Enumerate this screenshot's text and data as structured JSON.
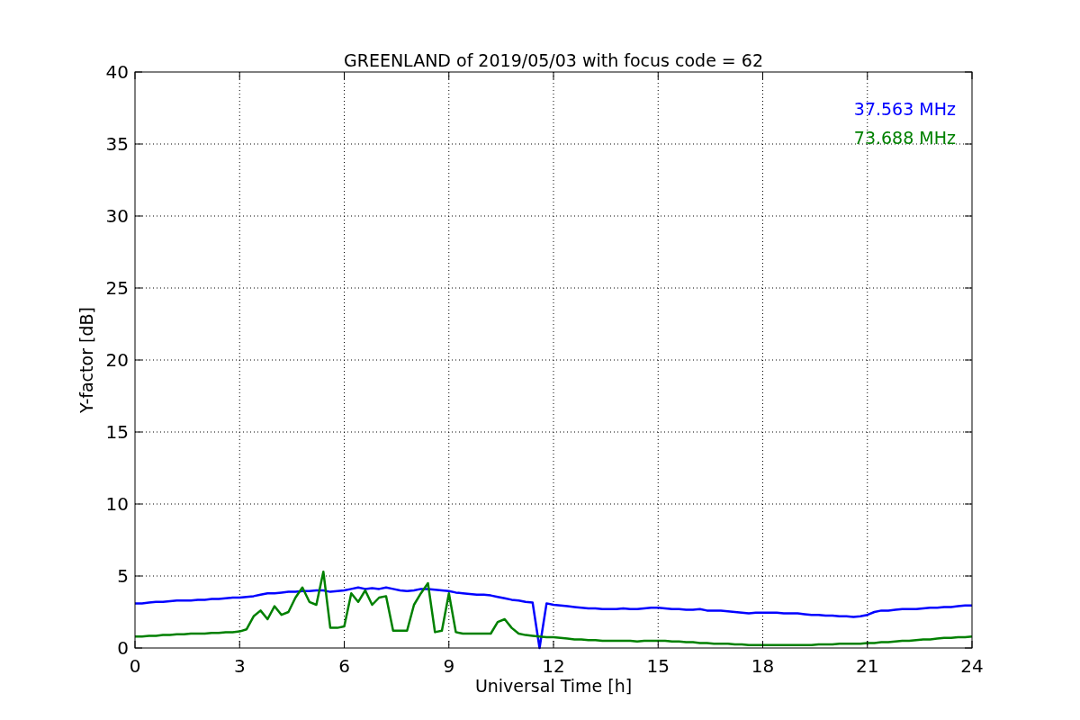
{
  "chart_data": {
    "type": "line",
    "title": "GREENLAND of 2019/05/03 with focus code = 62",
    "xlabel": "Universal Time [h]",
    "ylabel": "Y-factor [dB]",
    "x": [
      0,
      0.2,
      0.4,
      0.6,
      0.8,
      1,
      1.2,
      1.4,
      1.6,
      1.8,
      2,
      2.2,
      2.4,
      2.6,
      2.8,
      3,
      3.2,
      3.4,
      3.6,
      3.8,
      4,
      4.2,
      4.4,
      4.6,
      4.8,
      5,
      5.2,
      5.4,
      5.6,
      5.8,
      6,
      6.2,
      6.4,
      6.6,
      6.8,
      7,
      7.2,
      7.4,
      7.6,
      7.8,
      8,
      8.2,
      8.4,
      8.6,
      8.8,
      9,
      9.2,
      9.4,
      9.6,
      9.8,
      10,
      10.2,
      10.4,
      10.6,
      10.8,
      11,
      11.2,
      11.4,
      11.6,
      11.8,
      12,
      12.2,
      12.4,
      12.6,
      12.8,
      13,
      13.2,
      13.4,
      13.6,
      13.8,
      14,
      14.2,
      14.4,
      14.6,
      14.8,
      15,
      15.2,
      15.4,
      15.6,
      15.8,
      16,
      16.2,
      16.4,
      16.6,
      16.8,
      17,
      17.2,
      17.4,
      17.6,
      17.8,
      18,
      18.2,
      18.4,
      18.6,
      18.8,
      19,
      19.2,
      19.4,
      19.6,
      19.8,
      20,
      20.2,
      20.4,
      20.6,
      20.8,
      21,
      21.2,
      21.4,
      21.6,
      21.8,
      22,
      22.2,
      22.4,
      22.6,
      22.8,
      23,
      23.2,
      23.4,
      23.6,
      23.8,
      24
    ],
    "series": [
      {
        "name": "37.563 MHz",
        "color": "#0000ff",
        "values": [
          3.1,
          3.1,
          3.15,
          3.2,
          3.2,
          3.25,
          3.3,
          3.3,
          3.3,
          3.35,
          3.35,
          3.4,
          3.4,
          3.45,
          3.5,
          3.5,
          3.55,
          3.6,
          3.7,
          3.8,
          3.8,
          3.85,
          3.9,
          3.9,
          3.95,
          3.95,
          4.0,
          4.0,
          3.9,
          3.95,
          4.0,
          4.1,
          4.2,
          4.1,
          4.15,
          4.1,
          4.2,
          4.1,
          4.0,
          3.95,
          4.0,
          4.1,
          4.1,
          4.05,
          4.0,
          3.95,
          3.85,
          3.8,
          3.75,
          3.7,
          3.7,
          3.65,
          3.55,
          3.45,
          3.35,
          3.3,
          3.2,
          3.15,
          0,
          3.1,
          3.0,
          2.95,
          2.9,
          2.85,
          2.8,
          2.75,
          2.75,
          2.7,
          2.7,
          2.7,
          2.75,
          2.7,
          2.7,
          2.75,
          2.8,
          2.8,
          2.75,
          2.7,
          2.7,
          2.65,
          2.65,
          2.7,
          2.6,
          2.6,
          2.6,
          2.55,
          2.5,
          2.45,
          2.4,
          2.45,
          2.45,
          2.45,
          2.45,
          2.4,
          2.4,
          2.4,
          2.35,
          2.3,
          2.3,
          2.25,
          2.25,
          2.2,
          2.2,
          2.15,
          2.2,
          2.3,
          2.5,
          2.6,
          2.6,
          2.65,
          2.7,
          2.7,
          2.7,
          2.75,
          2.8,
          2.8,
          2.85,
          2.85,
          2.9,
          2.95,
          2.95
        ]
      },
      {
        "name": "73.688 MHz",
        "color": "#008000",
        "values": [
          0.8,
          0.8,
          0.85,
          0.85,
          0.9,
          0.9,
          0.95,
          0.95,
          1.0,
          1.0,
          1.0,
          1.05,
          1.05,
          1.1,
          1.1,
          1.15,
          1.3,
          2.2,
          2.6,
          2.0,
          2.9,
          2.3,
          2.5,
          3.5,
          4.2,
          3.2,
          3.0,
          5.3,
          1.4,
          1.4,
          1.5,
          3.8,
          3.2,
          4.0,
          3.0,
          3.5,
          3.6,
          1.2,
          1.2,
          1.2,
          3.0,
          3.8,
          4.5,
          1.1,
          1.2,
          3.8,
          1.1,
          1.0,
          1.0,
          1.0,
          1.0,
          1.0,
          1.8,
          2.0,
          1.4,
          1.0,
          0.9,
          0.85,
          0.8,
          0.75,
          0.75,
          0.7,
          0.65,
          0.6,
          0.6,
          0.55,
          0.55,
          0.5,
          0.5,
          0.5,
          0.5,
          0.5,
          0.45,
          0.5,
          0.5,
          0.5,
          0.5,
          0.45,
          0.45,
          0.4,
          0.4,
          0.35,
          0.35,
          0.3,
          0.3,
          0.3,
          0.25,
          0.25,
          0.2,
          0.2,
          0.2,
          0.2,
          0.2,
          0.2,
          0.2,
          0.2,
          0.2,
          0.2,
          0.25,
          0.25,
          0.25,
          0.3,
          0.3,
          0.3,
          0.3,
          0.35,
          0.35,
          0.4,
          0.4,
          0.45,
          0.5,
          0.5,
          0.55,
          0.6,
          0.6,
          0.65,
          0.7,
          0.7,
          0.75,
          0.75,
          0.8
        ]
      }
    ],
    "xlim": [
      0,
      24
    ],
    "ylim": [
      0,
      40
    ],
    "xticks": [
      0,
      3,
      6,
      9,
      12,
      15,
      18,
      21,
      24
    ],
    "yticks": [
      0,
      5,
      10,
      15,
      20,
      25,
      30,
      35,
      40
    ],
    "grid": true
  }
}
